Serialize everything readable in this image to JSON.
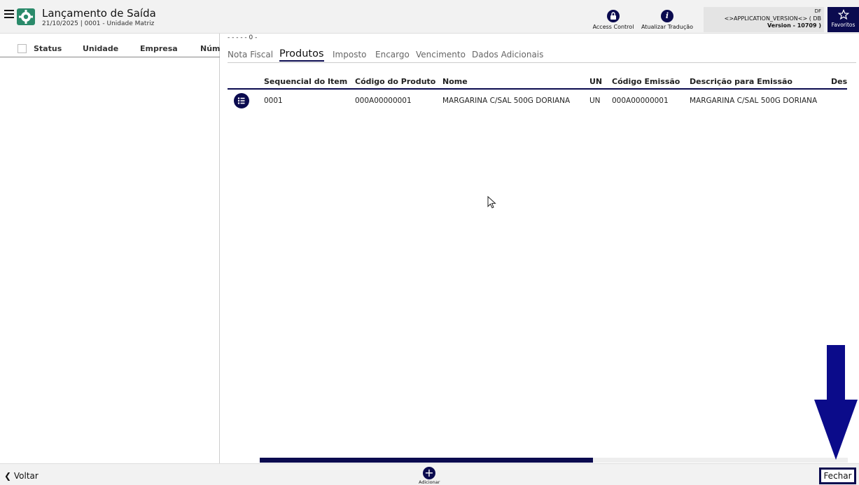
{
  "header": {
    "title": "Lançamento de Saída",
    "subtitle": "21/10/2025 | 0001 - Unidade Matriz",
    "access_control_label": "Access Control",
    "translate_label": "Atualizar Tradução",
    "version_line1": "DF",
    "version_line2": "<>APPLICATION_VERSION<> ( DB",
    "version_line3": "Version - 10709 )",
    "favorites_label": "Favoritos"
  },
  "left_grid": {
    "columns": [
      "Status",
      "Unidade",
      "Empresa",
      "Núm"
    ]
  },
  "record_nav": "- - - - - 0 -",
  "tabs": [
    {
      "label": "Nota Fiscal",
      "active": false
    },
    {
      "label": "Produtos",
      "active": true
    },
    {
      "label": "Imposto",
      "active": false
    },
    {
      "label": "Encargo",
      "active": false
    },
    {
      "label": "Vencimento",
      "active": false
    },
    {
      "label": "Dados Adicionais",
      "active": false
    }
  ],
  "products_grid": {
    "columns": [
      "Sequencial do Item",
      "Código do Produto",
      "Nome",
      "UN",
      "Código Emissão",
      "Descrição para Emissão",
      "Descri"
    ],
    "rows": [
      [
        "0001",
        "000A00000001",
        "MARGARINA C/SAL 500G DORIANA",
        "UN",
        "000A00000001",
        "MARGARINA C/SAL 500G DORIANA",
        ""
      ]
    ]
  },
  "footer": {
    "back_label": "Voltar",
    "add_label": "Adicionar",
    "close_label": "Fechar"
  },
  "colors": {
    "accent": "#0b0b4f",
    "bar_bg": "#f2f2f2",
    "icon_green": "#2a8a6a"
  },
  "icons": [
    "menu-icon",
    "app-gear-icon",
    "lock-icon",
    "info-icon",
    "star-icon",
    "list-icon",
    "plus-icon",
    "chevron-left-icon",
    "down-arrow-icon",
    "mouse-cursor-icon"
  ]
}
